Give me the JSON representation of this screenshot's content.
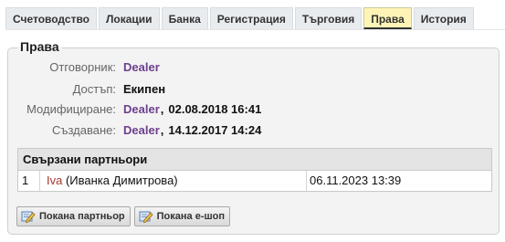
{
  "tabs": [
    {
      "label": "Счетоводство"
    },
    {
      "label": "Локации"
    },
    {
      "label": "Банка"
    },
    {
      "label": "Регистрация"
    },
    {
      "label": "Търговия"
    },
    {
      "label": "Права"
    },
    {
      "label": "История"
    }
  ],
  "active_tab": "Права",
  "section": {
    "title": "Права",
    "fields": {
      "owner": {
        "label": "Отговорник:",
        "value": "Dealer"
      },
      "access": {
        "label": "Достъп:",
        "value": "Екипен"
      },
      "modified": {
        "label": "Модифициране:",
        "user": "Dealer",
        "separator": ",",
        "datetime": "02.08.2018 16:41"
      },
      "created": {
        "label": "Създаване:",
        "user": "Dealer",
        "separator": ",",
        "datetime": "14.12.2017 14:24"
      }
    }
  },
  "partners": {
    "header": "Свързани партньори",
    "rows": [
      {
        "index": "1",
        "name": "Iva",
        "full_name": "(Иванка Димитрова)",
        "datetime": "06.11.2023 13:39"
      }
    ]
  },
  "buttons": {
    "invite_partner": "Покана партньор",
    "invite_eshop": "Покана е-шоп"
  },
  "colors": {
    "active_tab_bg": "#fff4b6",
    "user_link": "#6e3f8f",
    "partner_link": "#a33a2e"
  },
  "icons": {
    "button_icon": "edit-pencil-icon"
  }
}
